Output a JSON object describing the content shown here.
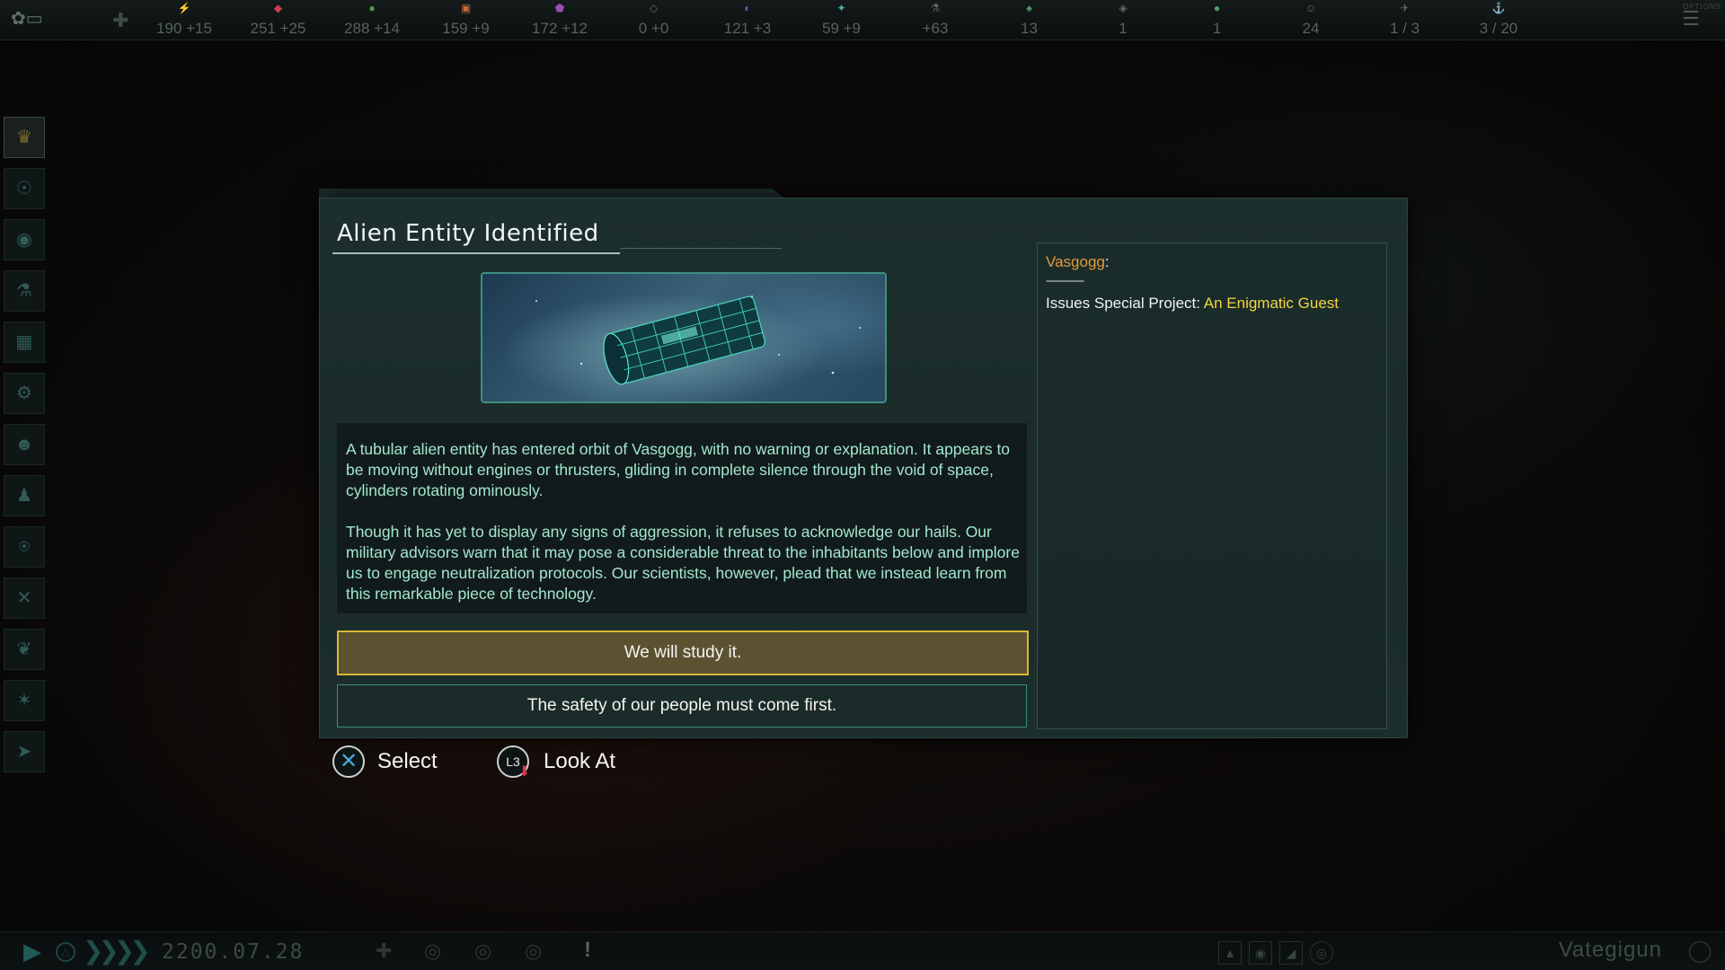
{
  "top_bar": {
    "resources": [
      {
        "name": "energy",
        "icon": "energy-icon",
        "value": "190 +15",
        "color": "#d9a53b"
      },
      {
        "name": "minerals",
        "icon": "minerals-icon",
        "value": "251 +25",
        "color": "#c2414e"
      },
      {
        "name": "food",
        "icon": "food-icon",
        "value": "288 +14",
        "color": "#4f9c47"
      },
      {
        "name": "consumer-goods",
        "icon": "consumer-goods-icon",
        "value": "159 +9",
        "color": "#c46a3a"
      },
      {
        "name": "alloys",
        "icon": "alloys-icon",
        "value": "172 +12",
        "color": "#9a4fb0"
      },
      {
        "name": "strategic",
        "icon": "strategic-icon",
        "value": "0 +0",
        "color": "#5d6a68"
      },
      {
        "name": "influence",
        "icon": "influence-icon",
        "value": "121 +3",
        "color": "#8059c6"
      },
      {
        "name": "unity",
        "icon": "unity-icon",
        "value": "59 +9",
        "color": "#4fb0a0"
      },
      {
        "name": "research",
        "icon": "research-icon",
        "value": "+63",
        "color": "#5d6a68"
      },
      {
        "name": "stability",
        "icon": "stability-icon",
        "value": "13",
        "color": "#4fa06b"
      },
      {
        "name": "trade",
        "icon": "trade-icon",
        "value": "1",
        "color": "#5d6a68"
      },
      {
        "name": "planets",
        "icon": "planets-icon",
        "value": "1",
        "color": "#4fa06b"
      },
      {
        "name": "pops",
        "icon": "pops-icon",
        "value": "24",
        "color": "#5d6a68"
      },
      {
        "name": "fleets",
        "icon": "fleets-icon",
        "value": "1 / 3",
        "color": "#5d6a68"
      },
      {
        "name": "naval-capacity",
        "icon": "naval-capacity-icon",
        "value": "3 / 20",
        "color": "#5d6a68"
      }
    ],
    "options_label": "OPTIONS"
  },
  "sidebar": {
    "items": [
      {
        "name": "government",
        "icon": "crown-icon",
        "active": true
      },
      {
        "name": "contacts",
        "icon": "contacts-icon"
      },
      {
        "name": "planets",
        "icon": "planets-icon"
      },
      {
        "name": "research",
        "icon": "flask-icon"
      },
      {
        "name": "expansion",
        "icon": "map-icon"
      },
      {
        "name": "traditions",
        "icon": "gears-icon"
      },
      {
        "name": "factions",
        "icon": "masks-icon"
      },
      {
        "name": "species",
        "icon": "person-icon"
      },
      {
        "name": "situation-log",
        "icon": "emblem-icon"
      },
      {
        "name": "military",
        "icon": "swords-icon"
      },
      {
        "name": "edicts",
        "icon": "leaf-icon"
      },
      {
        "name": "leaders",
        "icon": "stars-icon"
      },
      {
        "name": "ships",
        "icon": "ship-icon"
      }
    ]
  },
  "dialog": {
    "title": "Alien Entity Identified",
    "image_alt": "alien-cylinder-entity",
    "description": [
      "A tubular alien entity has entered orbit of Vasgogg, with no warning or explanation. It appears to be moving without engines or thrusters, gliding in complete silence through the void of space, cylinders rotating ominously.",
      "Though it has yet to display any signs of aggression, it refuses to acknowledge our hails. Our military advisors warn that it may pose a considerable threat to the inhabitants below and implore us to engage neutralization protocols. Our scientists, however, plead that we instead learn from this remarkable piece of technology."
    ],
    "options": [
      {
        "label": "We will study it.",
        "selected": true
      },
      {
        "label": "The safety of our people must come first.",
        "selected": false
      }
    ],
    "effects": {
      "planet_name": "Vasgogg",
      "separator": "--------------",
      "effect_prefix": "Issues Special Project: ",
      "project_name": "An Enigmatic Guest"
    }
  },
  "prompts": {
    "select_label": "Select",
    "select_button": "cross-button",
    "look_label": "Look At",
    "look_button": "L3"
  },
  "bottom_bar": {
    "date": "2200.07.28",
    "empire_name": "Vategigun"
  }
}
